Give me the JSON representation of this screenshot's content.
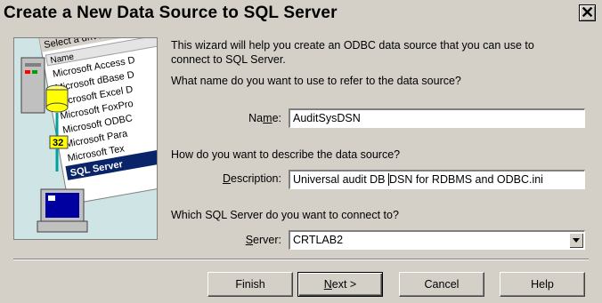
{
  "window": {
    "title": "Create a New Data Source to SQL Server",
    "close_glyph": "✕"
  },
  "illustration": {
    "heading": "Select a driver for",
    "list_header": "Name",
    "drivers": [
      "Microsoft Access D",
      "Microsoft dBase D",
      "Microsoft Excel D",
      "Microsoft FoxPro",
      "Microsoft ODBC",
      "Microsoft Para",
      "Microsoft Tex",
      "SQL Server"
    ],
    "badge": "32"
  },
  "intro": {
    "line1": "This wizard will help you create an ODBC data source that you can use to",
    "line2": "connect to SQL Server."
  },
  "name_section": {
    "question": "What name do you want to use to refer to the data source?",
    "label_prefix": "Na",
    "label_mnemonic": "m",
    "label_suffix": "e:",
    "value": "AuditSysDSN"
  },
  "description_section": {
    "question": "How do you want to describe the data source?",
    "label_mnemonic": "D",
    "label_suffix": "escription:",
    "value_before_caret": "Universal audit DB ",
    "value_after_caret": "DSN for RDBMS and ODBC.ini"
  },
  "server_section": {
    "question": "Which SQL Server do you want to connect to?",
    "label_mnemonic": "S",
    "label_suffix": "erver:",
    "value": "CRTLAB2"
  },
  "buttons": {
    "finish": "Finish",
    "next_mnemonic": "N",
    "next_suffix": "ext >",
    "cancel": "Cancel",
    "help": "Help"
  }
}
